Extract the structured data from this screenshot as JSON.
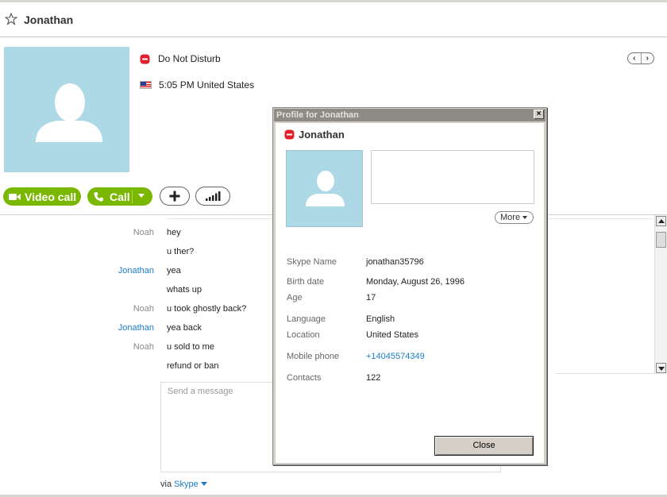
{
  "header": {
    "title": "Jonathan"
  },
  "contact": {
    "status": "Do Not Disturb",
    "local_time": "5:05 PM United States"
  },
  "actions": {
    "video_call": "Video call",
    "call": "Call"
  },
  "chat": {
    "messages": [
      {
        "sender": "Noah",
        "text": "hey",
        "sender_color": "#8a8a8a"
      },
      {
        "sender": "",
        "text": "u ther?"
      },
      {
        "sender": "Jonathan",
        "text": "yea",
        "sender_color": "#1a7cc5"
      },
      {
        "sender": "",
        "text": "whats up"
      },
      {
        "sender": "Noah",
        "text": "u took ghostly back?",
        "sender_color": "#8a8a8a"
      },
      {
        "sender": "Jonathan",
        "text": "yea back",
        "sender_color": "#1a7cc5"
      },
      {
        "sender": "Noah",
        "text": "u sold to me",
        "sender_color": "#8a8a8a"
      },
      {
        "sender": "",
        "text": "refund or ban"
      }
    ]
  },
  "composer": {
    "placeholder": "Send a message",
    "via_prefix": "via",
    "via_service": "Skype"
  },
  "profile_dialog": {
    "title": "Profile for Jonathan",
    "name": "Jonathan",
    "more_label": "More",
    "fields": [
      {
        "label": "Skype Name",
        "value": "jonathan35796"
      },
      {
        "label": "Birth date",
        "value": "Monday, August 26, 1996"
      },
      {
        "label": "Age",
        "value": "17"
      },
      {
        "label": "Language",
        "value": "English"
      },
      {
        "label": "Location",
        "value": "United States"
      },
      {
        "label": "Mobile phone",
        "value": "+14045574349"
      },
      {
        "label": "Contacts",
        "value": "122"
      }
    ],
    "close_label": "Close"
  },
  "colors": {
    "accent_green": "#7ab800",
    "link_blue": "#1a7cc5",
    "avatar_bg": "#add8e6",
    "dnd_red": "#e0202a"
  }
}
